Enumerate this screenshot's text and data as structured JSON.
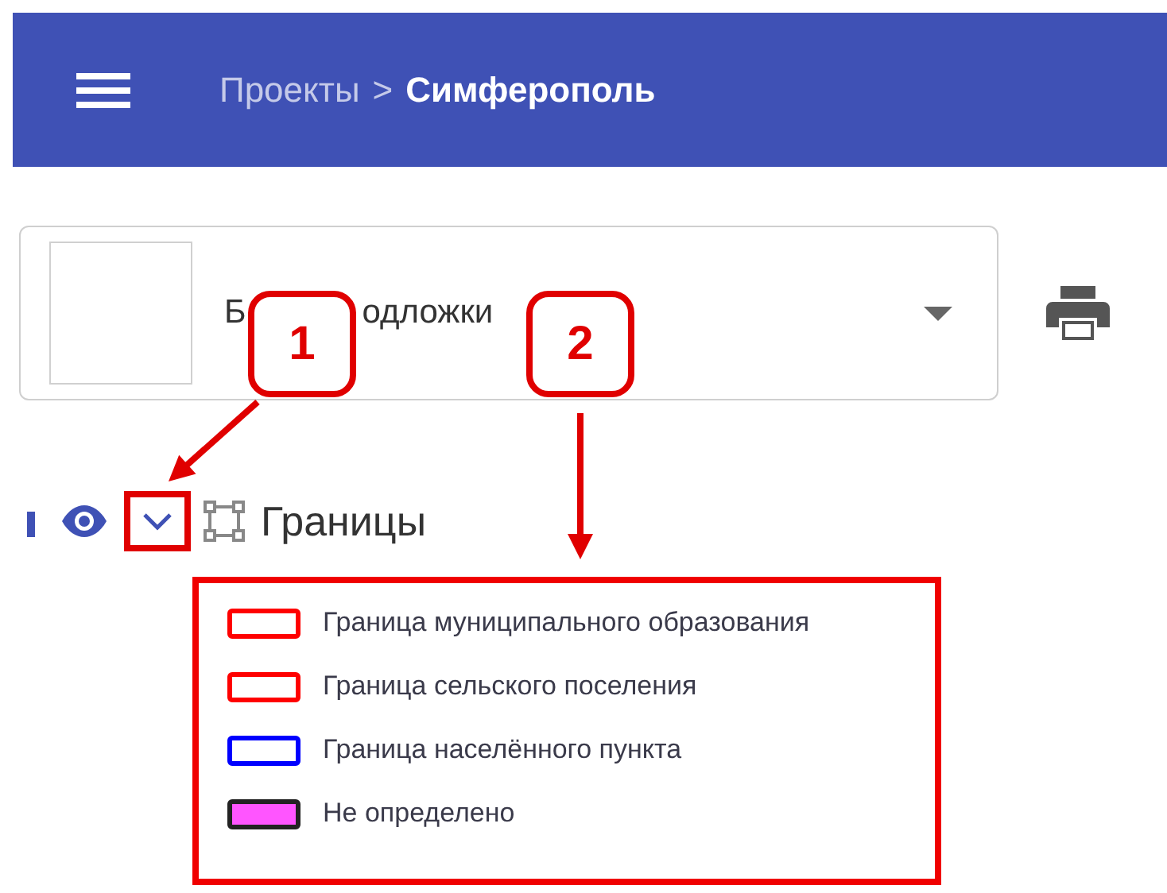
{
  "header": {
    "breadcrumb": [
      {
        "label": "Проекты",
        "current": false
      },
      {
        "label": ">",
        "current": false
      },
      {
        "label": "Симферополь",
        "current": true
      }
    ]
  },
  "basemap_select": {
    "value_parts": [
      "Б",
      "одложки"
    ]
  },
  "layer": {
    "name": "Границы",
    "visible": true,
    "expanded": true,
    "expand_highlighted": true
  },
  "legend": {
    "highlighted": true,
    "items": [
      {
        "label": "Граница муниципального образования",
        "color": "#ff0000",
        "filled": false
      },
      {
        "label": "Граница сельского поселения",
        "color": "#ff0000",
        "filled": false
      },
      {
        "label": "Граница населённого пункта",
        "color": "#0000ff",
        "filled": false
      },
      {
        "label": "Не определено",
        "color": "#ff55ff",
        "filled": true
      }
    ]
  },
  "annotations": [
    {
      "label": "1"
    },
    {
      "label": "2"
    }
  ]
}
